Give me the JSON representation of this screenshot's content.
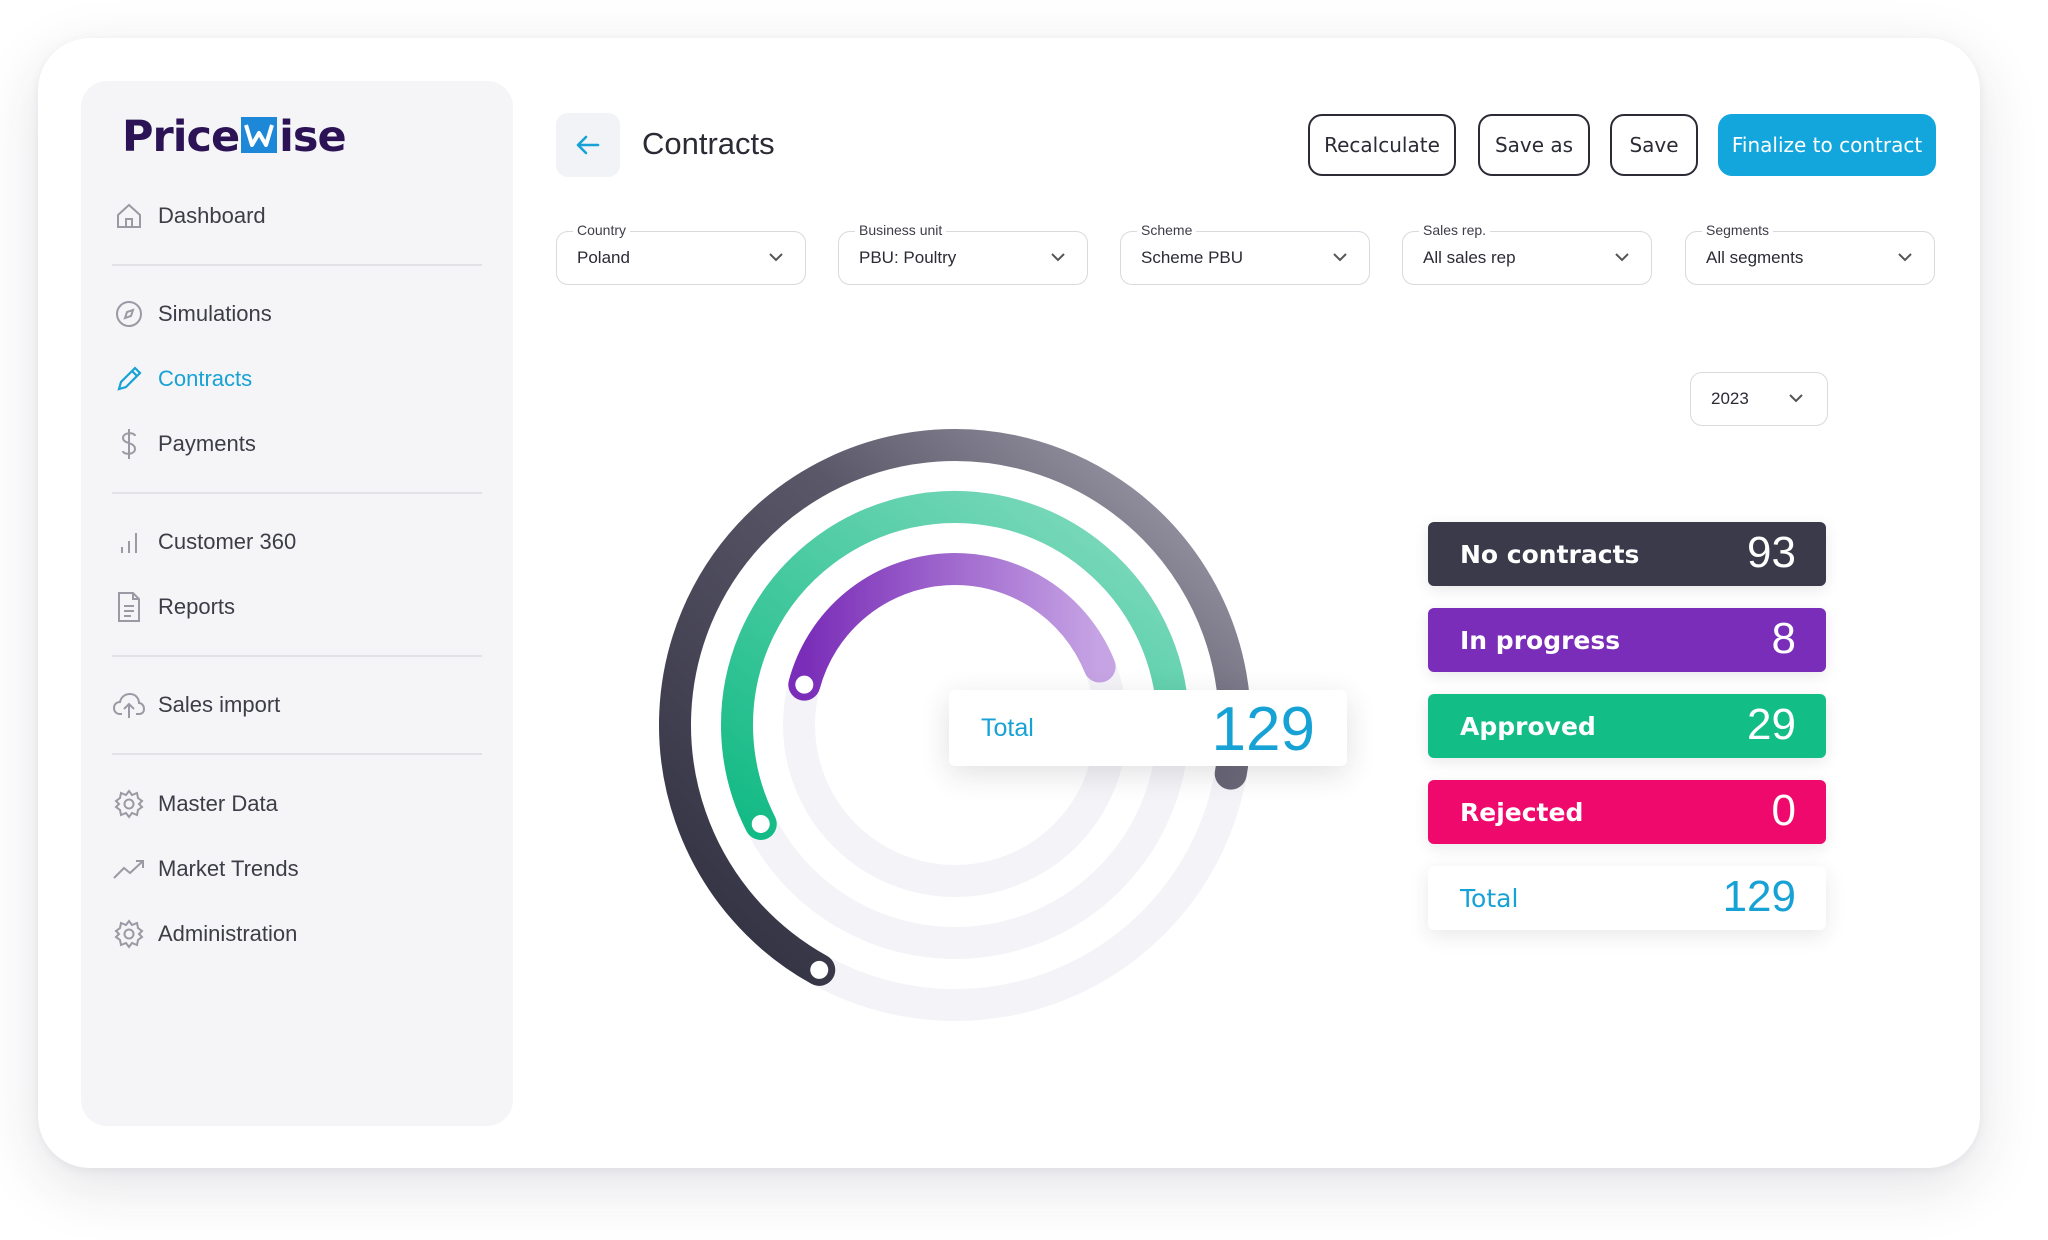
{
  "app": {
    "brand_left": "Price",
    "brand_right": "ise"
  },
  "sidebar": {
    "items": [
      {
        "label": "Dashboard",
        "icon": "home-icon"
      },
      {
        "label": "Simulations",
        "icon": "compass-icon"
      },
      {
        "label": "Contracts",
        "icon": "pencil-icon",
        "active": true
      },
      {
        "label": "Payments",
        "icon": "dollar-icon"
      },
      {
        "label": "Customer 360",
        "icon": "bar-chart-icon"
      },
      {
        "label": "Reports",
        "icon": "document-icon"
      },
      {
        "label": "Sales import",
        "icon": "cloud-upload-icon"
      },
      {
        "label": "Master Data",
        "icon": "gear-icon"
      },
      {
        "label": "Market Trends",
        "icon": "trend-icon"
      },
      {
        "label": "Administration",
        "icon": "gear-icon"
      }
    ]
  },
  "header": {
    "title": "Contracts",
    "buttons": {
      "recalculate": "Recalculate",
      "save_as": "Save as",
      "save": "Save",
      "finalize": "Finalize to contract"
    }
  },
  "filters": [
    {
      "label": "Country",
      "value": "Poland"
    },
    {
      "label": "Business unit",
      "value": "PBU: Poultry"
    },
    {
      "label": "Scheme",
      "value": "Scheme PBU"
    },
    {
      "label": "Sales rep.",
      "value": "All sales rep"
    },
    {
      "label": "Segments",
      "value": "All segments"
    }
  ],
  "year": "2023",
  "summary": {
    "total_label": "Total",
    "total_value": "129",
    "items": [
      {
        "label": "No contracts",
        "value": "93",
        "color": "#3b3a4b"
      },
      {
        "label": "In progress",
        "value": "8",
        "color": "#7a2db8"
      },
      {
        "label": "Approved",
        "value": "29",
        "color": "#13bd86"
      },
      {
        "label": "Rejected",
        "value": "0",
        "color": "#f0096c"
      }
    ]
  },
  "colors": {
    "accent": "#17a2d6",
    "brand": "#2b1356"
  }
}
